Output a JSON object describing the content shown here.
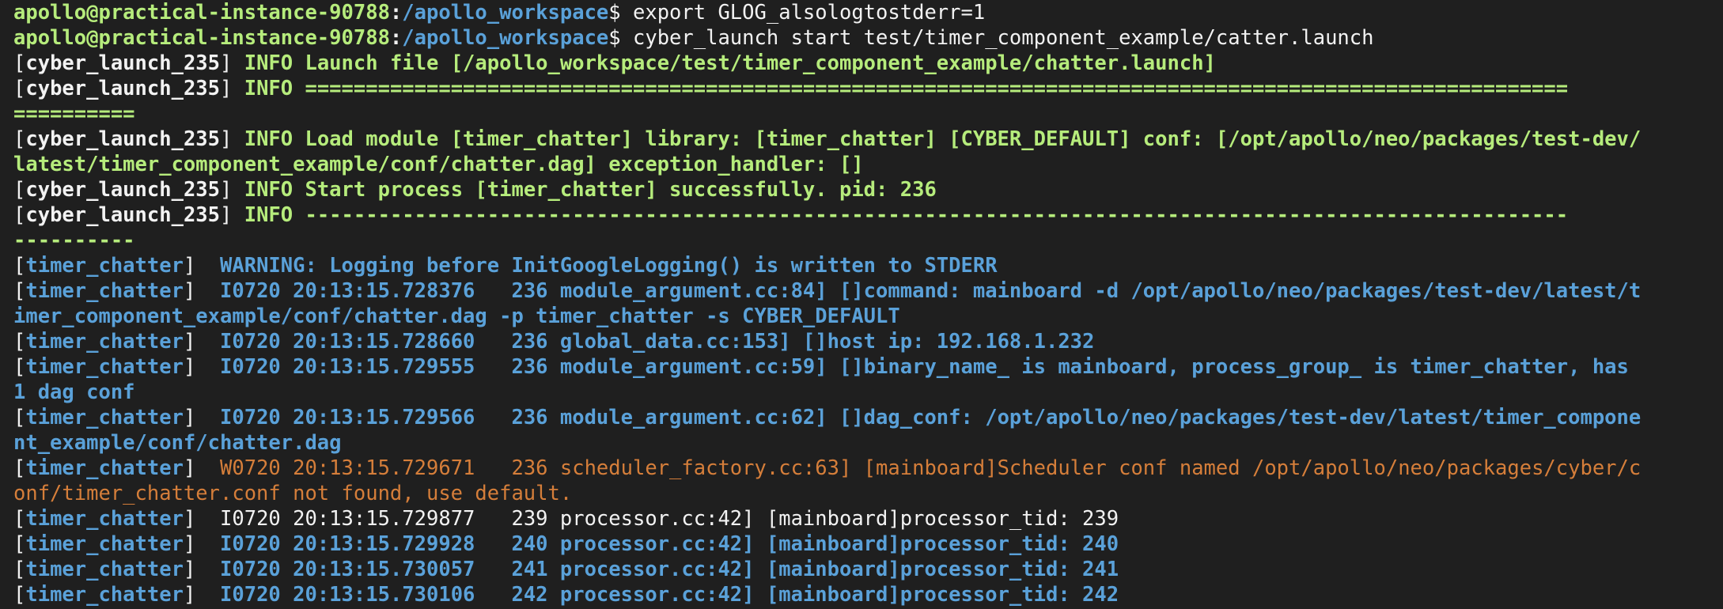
{
  "colors": {
    "background": "#1f1f1f",
    "prompt_user": "#b6ec7c",
    "prompt_path": "#5aa1d9",
    "default_text": "#f2f2f2",
    "info_green": "#b6ec7c",
    "log_blue": "#5aa1d9",
    "warning_orange": "#d57e3a"
  },
  "lines": [
    [
      {
        "t": "apollo@practical-instance-90788",
        "c": "#b6ec7c",
        "b": 1
      },
      {
        "t": ":",
        "c": "#f2f2f2",
        "b": 1
      },
      {
        "t": "/apollo_workspace",
        "c": "#5aa1d9",
        "b": 1
      },
      {
        "t": "$ export GLOG_alsologtostderr=1",
        "c": "#f2f2f2",
        "b": 0
      }
    ],
    [
      {
        "t": "apollo@practical-instance-90788",
        "c": "#b6ec7c",
        "b": 1
      },
      {
        "t": ":",
        "c": "#f2f2f2",
        "b": 1
      },
      {
        "t": "/apollo_workspace",
        "c": "#5aa1d9",
        "b": 1
      },
      {
        "t": "$ cyber_launch start test/timer_component_example/catter.launch",
        "c": "#f2f2f2",
        "b": 0
      }
    ],
    [
      {
        "t": "[",
        "c": "#f2f2f2",
        "b": 0
      },
      {
        "t": "cyber_launch_235",
        "c": "#f2f2f2",
        "b": 1
      },
      {
        "t": "] ",
        "c": "#f2f2f2",
        "b": 0
      },
      {
        "t": "INFO Launch file [/apollo_workspace/test/timer_component_example/chatter.launch]",
        "c": "#b6ec7c",
        "b": 1
      }
    ],
    [
      {
        "t": "[",
        "c": "#f2f2f2",
        "b": 0
      },
      {
        "t": "cyber_launch_235",
        "c": "#f2f2f2",
        "b": 1
      },
      {
        "t": "] ",
        "c": "#f2f2f2",
        "b": 0
      },
      {
        "t": "INFO ========================================================================================================",
        "c": "#b6ec7c",
        "b": 1
      }
    ],
    [
      {
        "t": "==========",
        "c": "#b6ec7c",
        "b": 1
      }
    ],
    [
      {
        "t": "[",
        "c": "#f2f2f2",
        "b": 0
      },
      {
        "t": "cyber_launch_235",
        "c": "#f2f2f2",
        "b": 1
      },
      {
        "t": "] ",
        "c": "#f2f2f2",
        "b": 0
      },
      {
        "t": "INFO Load module [timer_chatter] library: [timer_chatter] [CYBER_DEFAULT] conf: [/opt/apollo/neo/packages/test-dev/",
        "c": "#b6ec7c",
        "b": 1
      }
    ],
    [
      {
        "t": "latest/timer_component_example/conf/chatter.dag] exception_handler: []",
        "c": "#b6ec7c",
        "b": 1
      }
    ],
    [
      {
        "t": "[",
        "c": "#f2f2f2",
        "b": 0
      },
      {
        "t": "cyber_launch_235",
        "c": "#f2f2f2",
        "b": 1
      },
      {
        "t": "] ",
        "c": "#f2f2f2",
        "b": 0
      },
      {
        "t": "INFO Start process [timer_chatter] successfully. pid: 236",
        "c": "#b6ec7c",
        "b": 1
      }
    ],
    [
      {
        "t": "[",
        "c": "#f2f2f2",
        "b": 0
      },
      {
        "t": "cyber_launch_235",
        "c": "#f2f2f2",
        "b": 1
      },
      {
        "t": "] ",
        "c": "#f2f2f2",
        "b": 0
      },
      {
        "t": "INFO --------------------------------------------------------------------------------------------------------",
        "c": "#b6ec7c",
        "b": 1
      }
    ],
    [
      {
        "t": "----------",
        "c": "#b6ec7c",
        "b": 1
      }
    ],
    [
      {
        "t": "[",
        "c": "#f2f2f2",
        "b": 0
      },
      {
        "t": "timer_chatter",
        "c": "#5aa1d9",
        "b": 1
      },
      {
        "t": "]  ",
        "c": "#f2f2f2",
        "b": 0
      },
      {
        "t": "WARNING: Logging before InitGoogleLogging() is written to STDERR",
        "c": "#5aa1d9",
        "b": 1
      }
    ],
    [
      {
        "t": "[",
        "c": "#f2f2f2",
        "b": 0
      },
      {
        "t": "timer_chatter",
        "c": "#5aa1d9",
        "b": 1
      },
      {
        "t": "]  ",
        "c": "#f2f2f2",
        "b": 0
      },
      {
        "t": "I0720 20:13:15.728376   236 module_argument.cc:84] []command: mainboard -d /opt/apollo/neo/packages/test-dev/latest/t",
        "c": "#5aa1d9",
        "b": 1
      }
    ],
    [
      {
        "t": "imer_component_example/conf/chatter.dag -p timer_chatter -s CYBER_DEFAULT",
        "c": "#5aa1d9",
        "b": 1
      }
    ],
    [
      {
        "t": "[",
        "c": "#f2f2f2",
        "b": 0
      },
      {
        "t": "timer_chatter",
        "c": "#5aa1d9",
        "b": 1
      },
      {
        "t": "]  ",
        "c": "#f2f2f2",
        "b": 0
      },
      {
        "t": "I0720 20:13:15.728660   236 global_data.cc:153] []host ip: 192.168.1.232",
        "c": "#5aa1d9",
        "b": 1
      }
    ],
    [
      {
        "t": "[",
        "c": "#f2f2f2",
        "b": 0
      },
      {
        "t": "timer_chatter",
        "c": "#5aa1d9",
        "b": 1
      },
      {
        "t": "]  ",
        "c": "#f2f2f2",
        "b": 0
      },
      {
        "t": "I0720 20:13:15.729555   236 module_argument.cc:59] []binary_name_ is mainboard, process_group_ is timer_chatter, has",
        "c": "#5aa1d9",
        "b": 1
      }
    ],
    [
      {
        "t": "1 dag conf",
        "c": "#5aa1d9",
        "b": 1
      }
    ],
    [
      {
        "t": "[",
        "c": "#f2f2f2",
        "b": 0
      },
      {
        "t": "timer_chatter",
        "c": "#5aa1d9",
        "b": 1
      },
      {
        "t": "]  ",
        "c": "#f2f2f2",
        "b": 0
      },
      {
        "t": "I0720 20:13:15.729566   236 module_argument.cc:62] []dag_conf: /opt/apollo/neo/packages/test-dev/latest/timer_compone",
        "c": "#5aa1d9",
        "b": 1
      }
    ],
    [
      {
        "t": "nt_example/conf/chatter.dag",
        "c": "#5aa1d9",
        "b": 1
      }
    ],
    [
      {
        "t": "[",
        "c": "#f2f2f2",
        "b": 0
      },
      {
        "t": "timer_chatter",
        "c": "#5aa1d9",
        "b": 1
      },
      {
        "t": "]  ",
        "c": "#f2f2f2",
        "b": 0
      },
      {
        "t": "W0720 20:13:15.729671   236 scheduler_factory.cc:63] [mainboard]Scheduler conf named /opt/apollo/neo/packages/cyber/c",
        "c": "#d57e3a",
        "b": 0
      }
    ],
    [
      {
        "t": "onf/timer_chatter.conf not found, use default.",
        "c": "#d57e3a",
        "b": 0
      }
    ],
    [
      {
        "t": "[",
        "c": "#f2f2f2",
        "b": 0
      },
      {
        "t": "timer_chatter",
        "c": "#5aa1d9",
        "b": 1
      },
      {
        "t": "]  ",
        "c": "#f2f2f2",
        "b": 0
      },
      {
        "t": "I0720 20:13:15.729877   239 processor.cc:42] [mainboard]processor_tid: 239",
        "c": "#f2f2f2",
        "b": 0
      }
    ],
    [
      {
        "t": "[",
        "c": "#f2f2f2",
        "b": 0
      },
      {
        "t": "timer_chatter",
        "c": "#5aa1d9",
        "b": 1
      },
      {
        "t": "]  ",
        "c": "#f2f2f2",
        "b": 0
      },
      {
        "t": "I0720 20:13:15.729928   240 processor.cc:42] [mainboard]processor_tid: 240",
        "c": "#5aa1d9",
        "b": 1
      }
    ],
    [
      {
        "t": "[",
        "c": "#f2f2f2",
        "b": 0
      },
      {
        "t": "timer_chatter",
        "c": "#5aa1d9",
        "b": 1
      },
      {
        "t": "]  ",
        "c": "#f2f2f2",
        "b": 0
      },
      {
        "t": "I0720 20:13:15.730057   241 processor.cc:42] [mainboard]processor_tid: 241",
        "c": "#5aa1d9",
        "b": 1
      }
    ],
    [
      {
        "t": "[",
        "c": "#f2f2f2",
        "b": 0
      },
      {
        "t": "timer_chatter",
        "c": "#5aa1d9",
        "b": 1
      },
      {
        "t": "]  ",
        "c": "#f2f2f2",
        "b": 0
      },
      {
        "t": "I0720 20:13:15.730106   242 processor.cc:42] [mainboard]processor_tid: 242",
        "c": "#5aa1d9",
        "b": 1
      }
    ]
  ]
}
